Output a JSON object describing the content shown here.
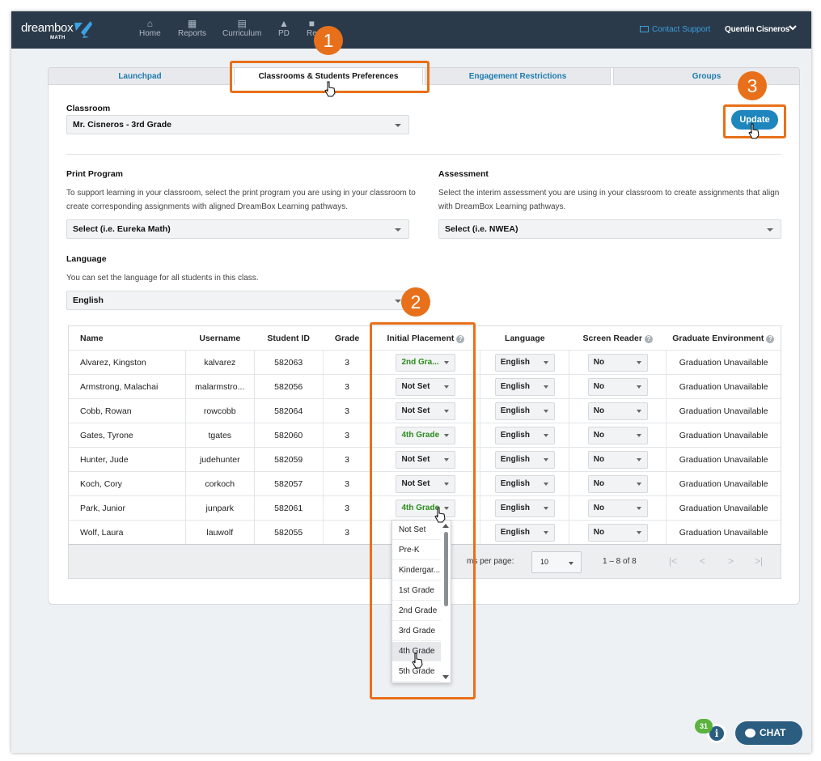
{
  "app": {
    "logo_text": "dreambox",
    "logo_sub": "MATH",
    "nav": [
      "Home",
      "Reports",
      "Curriculum",
      "PD",
      "Re"
    ],
    "contact_support": "Contact Support",
    "user_name": "Quentin Cisneros"
  },
  "tabs": [
    "Launchpad",
    "Classrooms & Students Preferences",
    "Engagement Restrictions",
    "Groups"
  ],
  "classroom": {
    "label": "Classroom",
    "value": "Mr. Cisneros - 3rd Grade"
  },
  "update_label": "Update",
  "print_program": {
    "label": "Print Program",
    "desc_line1": "To support learning in your classroom, select the print program you are using in your classroom to",
    "desc_line2": "create corresponding assignments with aligned DreamBox Learning pathways.",
    "value": "Select (i.e. Eureka Math)"
  },
  "assessment": {
    "label": "Assessment",
    "desc_line1": "Select the interim assessment you are using in your classroom to create assignments that align",
    "desc_line2": "with DreamBox Learning pathways.",
    "value": "Select (i.e. NWEA)"
  },
  "language": {
    "label": "Language",
    "desc": "You can set the language for all students in this class.",
    "value": "English"
  },
  "table": {
    "headers": [
      "Name",
      "Username",
      "Student ID",
      "Grade",
      "Initial Placement",
      "Language",
      "Screen Reader",
      "Graduate Environment"
    ],
    "rows": [
      {
        "name": "Alvarez, Kingston",
        "username": "kalvarez",
        "id": "582063",
        "grade": "3",
        "placement": "2nd Gra...",
        "language": "English",
        "reader": "No",
        "env": "Graduation Unavailable"
      },
      {
        "name": "Armstrong, Malachai",
        "username": "malarmstro...",
        "id": "582056",
        "grade": "3",
        "placement": "Not Set",
        "language": "English",
        "reader": "No",
        "env": "Graduation Unavailable"
      },
      {
        "name": "Cobb, Rowan",
        "username": "rowcobb",
        "id": "582064",
        "grade": "3",
        "placement": "Not Set",
        "language": "English",
        "reader": "No",
        "env": "Graduation Unavailable"
      },
      {
        "name": "Gates, Tyrone",
        "username": "tgates",
        "id": "582060",
        "grade": "3",
        "placement": "4th Grade",
        "language": "English",
        "reader": "No",
        "env": "Graduation Unavailable"
      },
      {
        "name": "Hunter, Jude",
        "username": "judehunter",
        "id": "582059",
        "grade": "3",
        "placement": "Not Set",
        "language": "English",
        "reader": "No",
        "env": "Graduation Unavailable"
      },
      {
        "name": "Koch, Cory",
        "username": "corkoch",
        "id": "582057",
        "grade": "3",
        "placement": "Not Set",
        "language": "English",
        "reader": "No",
        "env": "Graduation Unavailable"
      },
      {
        "name": "Park, Junior",
        "username": "junpark",
        "id": "582061",
        "grade": "3",
        "placement": "4th Grade",
        "language": "English",
        "reader": "No",
        "env": "Graduation Unavailable"
      },
      {
        "name": "Wolf, Laura",
        "username": "lauwolf",
        "id": "582055",
        "grade": "3",
        "placement": "",
        "language": "English",
        "reader": "No",
        "env": "Graduation Unavailable"
      }
    ]
  },
  "pager": {
    "label": "Items per page:",
    "label_visible": "ms per page:",
    "per_page": "10",
    "range": "1 – 8 of 8"
  },
  "placement_menu": [
    "Not Set",
    "Pre-K",
    "Kindergar...",
    "1st Grade",
    "2nd Grade",
    "3rd Grade",
    "4th Grade",
    "5th Grade"
  ],
  "callouts": [
    "1",
    "2",
    "3"
  ],
  "chat": {
    "label": "CHAT",
    "notif_count": "31",
    "info": "i"
  },
  "colors": {
    "topbar": "#2b3a4a",
    "accent": "#1e86bd",
    "callout": "#e8701a",
    "green_text": "#2c8c1e"
  }
}
